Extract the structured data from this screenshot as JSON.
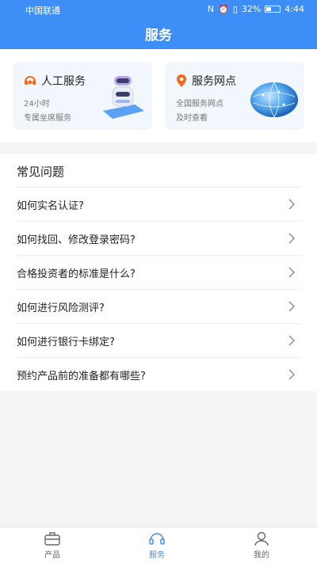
{
  "status_bar": {
    "carrier": "中国联通",
    "battery": "32%",
    "time": "4:44"
  },
  "header": {
    "title": "服务"
  },
  "cards": [
    {
      "title": "人工服务",
      "line1": "24小时",
      "line2": "专属坐席服务",
      "icon": "headset-icon"
    },
    {
      "title": "服务网点",
      "line1": "全国服务网点",
      "line2": "及时查看",
      "icon": "location-pin-icon"
    }
  ],
  "faq": {
    "heading": "常见问题",
    "items": [
      "如何实名认证?",
      "如何找回、修改登录密码?",
      "合格投资者的标准是什么?",
      "如何进行风险测评?",
      "如何进行银行卡绑定?",
      "预约产品前的准备都有哪些?"
    ]
  },
  "tabbar": {
    "items": [
      {
        "label": "产品",
        "icon": "briefcase-icon"
      },
      {
        "label": "服务",
        "icon": "headset-icon"
      },
      {
        "label": "我的",
        "icon": "person-icon"
      }
    ],
    "active": "服务"
  },
  "colors": {
    "primary": "#3e8ef7",
    "accent_orange": "#f26b1d"
  }
}
